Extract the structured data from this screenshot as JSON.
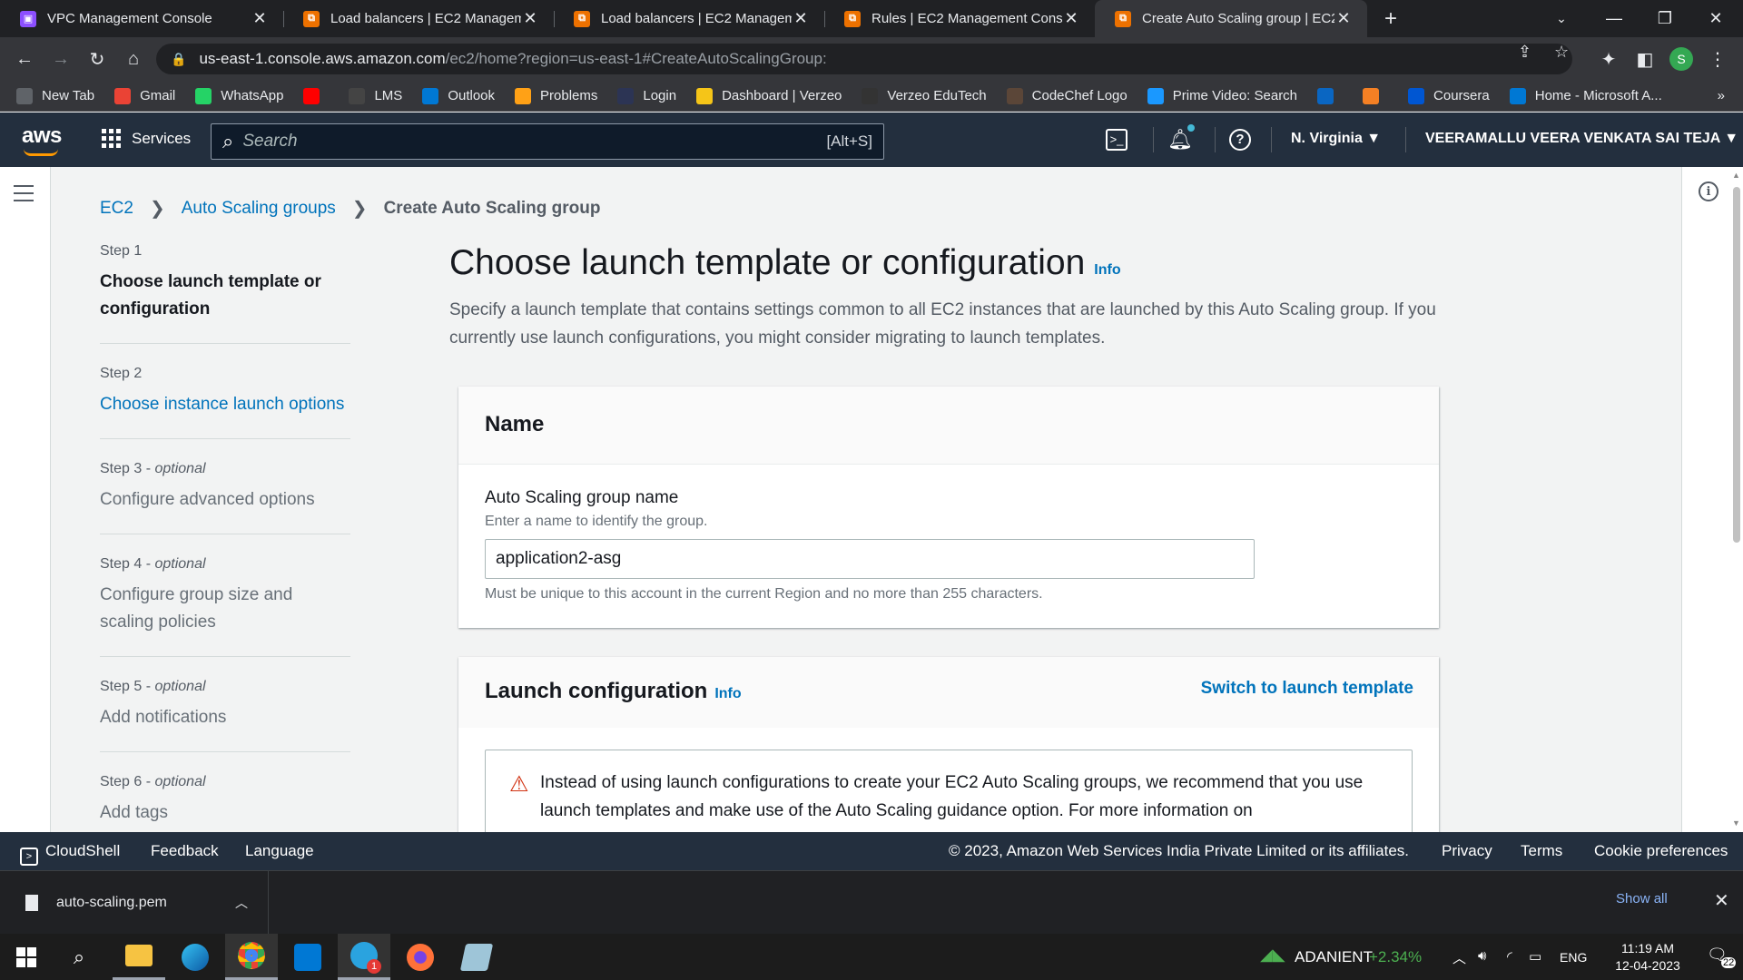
{
  "browser": {
    "tabs": [
      {
        "title": "VPC Management Console",
        "icon_color": "#8c4fff",
        "active": false
      },
      {
        "title": "Load balancers | EC2 Managemen",
        "icon_color": "#ed7100",
        "active": false
      },
      {
        "title": "Load balancers | EC2 Managemen",
        "icon_color": "#ed7100",
        "active": false
      },
      {
        "title": "Rules | EC2 Management Consol",
        "icon_color": "#ed7100",
        "active": false
      },
      {
        "title": "Create Auto Scaling group | EC2",
        "icon_color": "#ed7100",
        "active": true
      }
    ],
    "new_tab_glyph": "+",
    "url_host": "us-east-1.console.aws.amazon.com",
    "url_path": "/ec2/home?region=us-east-1#CreateAutoScalingGroup:",
    "profile_initial": "S",
    "bookmarks": [
      {
        "label": "New Tab",
        "icon": "globe-icon",
        "color": "#5f6368"
      },
      {
        "label": "Gmail",
        "icon": "gmail-icon",
        "color": "#ea4335"
      },
      {
        "label": "WhatsApp",
        "icon": "whatsapp-icon",
        "color": "#25d366"
      },
      {
        "label": "",
        "icon": "youtube-icon",
        "color": "#ff0000"
      },
      {
        "label": "LMS",
        "icon": "lms-icon",
        "color": "#444"
      },
      {
        "label": "Outlook",
        "icon": "outlook-icon",
        "color": "#0078d4"
      },
      {
        "label": "Problems",
        "icon": "leetcode-icon",
        "color": "#ffa116"
      },
      {
        "label": "Login",
        "icon": "hackerearth-icon",
        "color": "#2c3454"
      },
      {
        "label": "Dashboard | Verzeo",
        "icon": "verzeo-icon",
        "color": "#f5c518"
      },
      {
        "label": "Verzeo EduTech",
        "icon": "verzeo-edutech-icon",
        "color": "#333"
      },
      {
        "label": "CodeChef Logo",
        "icon": "codechef-icon",
        "color": "#5b4638"
      },
      {
        "label": "Prime Video: Search",
        "icon": "prime-video-icon",
        "color": "#1a98ff"
      },
      {
        "label": "",
        "icon": "linkedin-icon",
        "color": "#0a66c2"
      },
      {
        "label": "",
        "icon": "box-icon",
        "color": "#f48024"
      },
      {
        "label": "Coursera",
        "icon": "coursera-icon",
        "color": "#0056d2"
      },
      {
        "label": "Home - Microsoft A...",
        "icon": "azure-icon",
        "color": "#0078d4"
      }
    ],
    "bookmarks_overflow": "»"
  },
  "aws_nav": {
    "logo": "aws",
    "services_label": "Services",
    "search_placeholder": "Search",
    "search_shortcut": "[Alt+S]",
    "region": "N. Virginia ▼",
    "account": "VEERAMALLU VEERA VENKATA SAI TEJA ▼"
  },
  "breadcrumb": {
    "items": [
      "EC2",
      "Auto Scaling groups"
    ],
    "current": "Create Auto Scaling group"
  },
  "steps": [
    {
      "step": "Step 1",
      "optional": "",
      "title": "Choose launch template or configuration",
      "state": "active"
    },
    {
      "step": "Step 2",
      "optional": "",
      "title": "Choose instance launch options",
      "state": "link"
    },
    {
      "step": "Step 3",
      "optional": "optional",
      "title": "Configure advanced options",
      "state": "disabled"
    },
    {
      "step": "Step 4",
      "optional": "optional",
      "title": "Configure group size and scaling policies",
      "state": "disabled"
    },
    {
      "step": "Step 5",
      "optional": "optional",
      "title": "Add notifications",
      "state": "disabled"
    },
    {
      "step": "Step 6",
      "optional": "optional",
      "title": "Add tags",
      "state": "disabled"
    }
  ],
  "page": {
    "title": "Choose launch template or configuration",
    "info": "Info",
    "description": "Specify a launch template that contains settings common to all EC2 instances that are launched by this Auto Scaling group. If you currently use launch configurations, you might consider migrating to launch templates."
  },
  "name_panel": {
    "header": "Name",
    "field_label": "Auto Scaling group name",
    "field_desc": "Enter a name to identify the group.",
    "value": "application2-asg",
    "constraint": "Must be unique to this account in the current Region and no more than 255 characters."
  },
  "launch_panel": {
    "header": "Launch configuration",
    "info": "Info",
    "switch_label": "Switch to launch template",
    "warning": "Instead of using launch configurations to create your EC2 Auto Scaling groups, we recommend that you use launch templates and make use of the Auto Scaling guidance option. For more information on"
  },
  "footer": {
    "cloudshell": "CloudShell",
    "feedback": "Feedback",
    "language": "Language",
    "copyright": "© 2023, Amazon Web Services India Private Limited or its affiliates.",
    "privacy": "Privacy",
    "terms": "Terms",
    "cookies": "Cookie preferences"
  },
  "downloads": {
    "file": "auto-scaling.pem",
    "show_all": "Show all"
  },
  "taskbar": {
    "stock_name": "ADANIENT",
    "stock_change": "+2.34%",
    "lang": "ENG",
    "time": "11:19 AM",
    "date": "12-04-2023",
    "notifications": "22",
    "telegram_badge": "1"
  }
}
